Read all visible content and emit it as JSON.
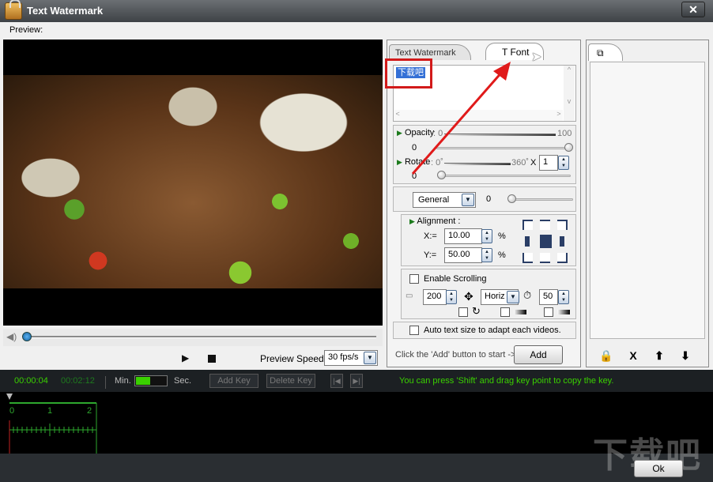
{
  "window": {
    "title": "Text Watermark",
    "close_label": "✕"
  },
  "preview": {
    "label": "Preview:"
  },
  "player": {
    "play_label": "▶",
    "speed_label": "Preview Speed:",
    "speed_value": "30 fps/s"
  },
  "tabs": {
    "text_watermark": "Text Watermark",
    "font": "T Font"
  },
  "watermark": {
    "text": "下载吧"
  },
  "opacity": {
    "label": "Opacity",
    "min": ": 0",
    "max": "100",
    "value": "0"
  },
  "rotate": {
    "label": "Rotate",
    "min": ": 0˚",
    "max": "360˚",
    "value": "0",
    "times": "X",
    "count": "1"
  },
  "general": {
    "select": "General",
    "value": "0"
  },
  "alignment": {
    "label": "Alignment :",
    "x_label": "X:=",
    "x_value": "10.00",
    "y_label": "Y:=",
    "y_value": "50.00",
    "percent": "%"
  },
  "scrolling": {
    "enable_label": "Enable Scrolling",
    "distance": "200",
    "direction": "Horiz",
    "speed": "50"
  },
  "auto_size": {
    "label": "Auto text size to adapt each videos."
  },
  "add": {
    "hint": "Click the 'Add' button to start ->",
    "button": "Add"
  },
  "key_panel": {
    "tab_icon": "layers-icon",
    "lock": "🔒",
    "delete": "X",
    "up": "⬆",
    "down": "⬇"
  },
  "timeline": {
    "current_time": "00:00:04",
    "total_time": "00:02:12",
    "min_label": "Min.",
    "sec_label": "Sec.",
    "add_key": "Add Key",
    "delete_key": "Delete Key",
    "hint": "You can press 'Shift' and drag key point to copy the key.",
    "ticks": [
      "0",
      "1",
      "2"
    ]
  },
  "footer": {
    "ok": "Ok",
    "site_watermark": "下载吧"
  },
  "colors": {
    "hint_green": "#3ad000",
    "highlight_red": "#d21a1a",
    "selection_blue": "#3470d6"
  }
}
